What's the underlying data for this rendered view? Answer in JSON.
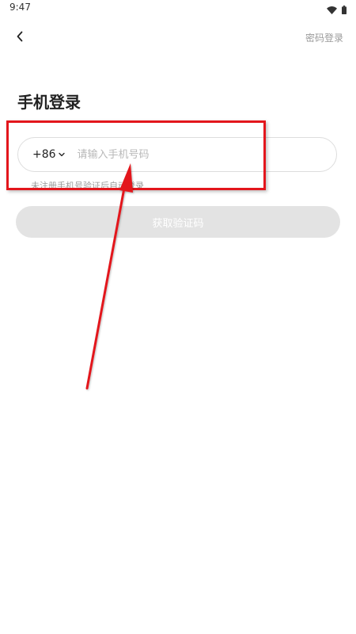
{
  "status_bar": {
    "time": "9:47",
    "icons": [
      "wifi-icon",
      "battery-icon"
    ]
  },
  "nav": {
    "back_icon": "chevron-left-icon",
    "password_login_label": "密码登录"
  },
  "page": {
    "title": "手机登录"
  },
  "phone_form": {
    "country_code": "+86",
    "country_code_icon": "chevron-down-icon",
    "phone_value": "",
    "phone_placeholder": "请输入手机号码",
    "hint": "未注册手机号验证后自动登录",
    "get_code_label": "获取验证码"
  },
  "colors": {
    "annotation": "#e3161c",
    "button_disabled": "#e3e3e3",
    "muted_text": "#9a9a9a"
  }
}
